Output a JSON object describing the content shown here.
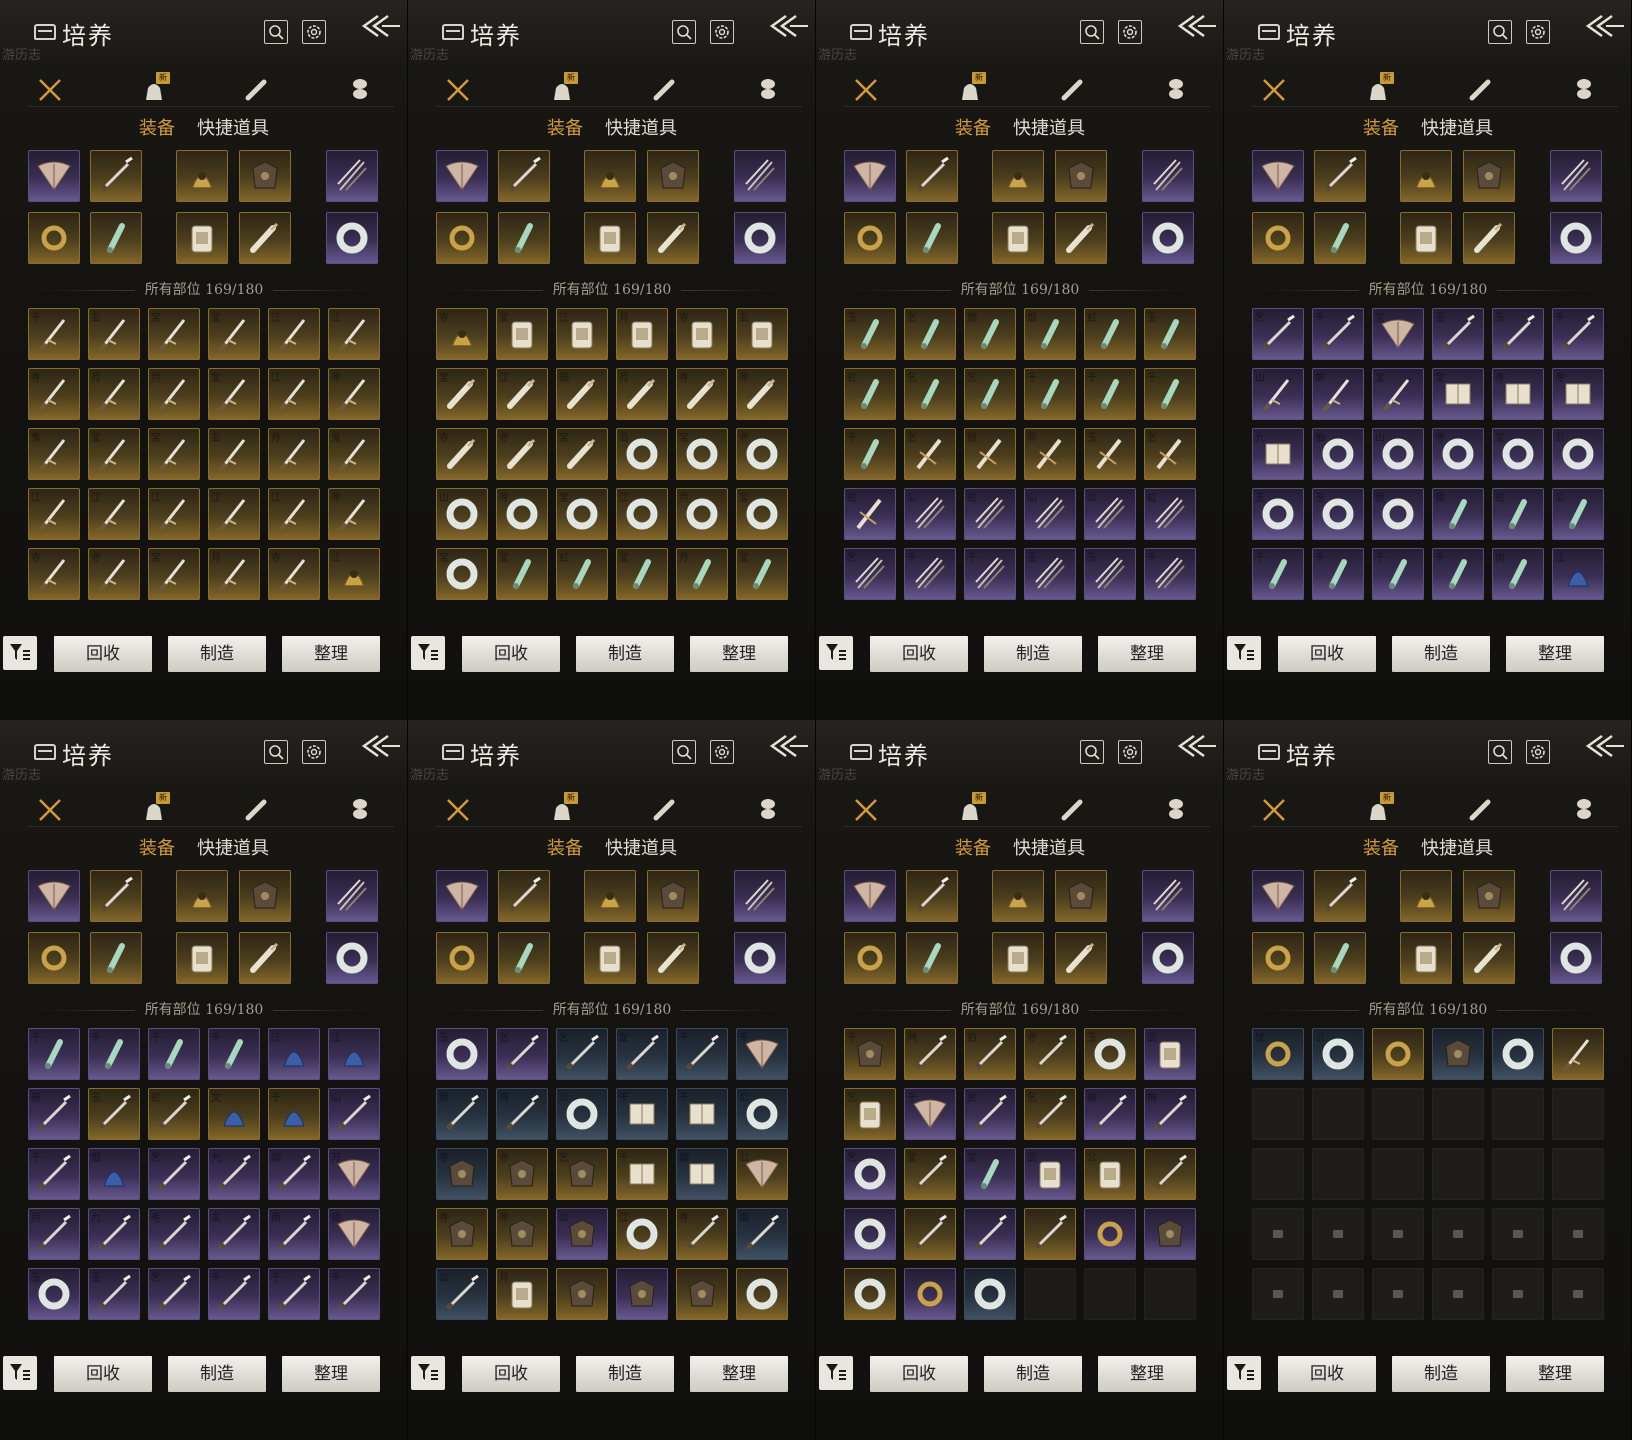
{
  "screens": [
    {
      "grid": "ggggggggggggggggggggggggggggggggggggggg",
      "chars": "千玄宝宝江江寺月月宝江寺鬼宝宝玄月鬼江江江江江寺寺寺宝月寺江宝月江千",
      "icons": "sssssssssssssssssssssssssssssaaaaaaaaaaahhhhhhhhh"
    },
    {
      "grid": "gggggggggggggggggggggggggggggggggggggggg",
      "chars": "寺宝江月寺玄宝江御月寺寺寺寺宝岛宝寺山寺宝江月宝宝宝虹宝月宝龙",
      "icons": "ahhhhhdddddddddrrrrrrrrrrjjjjj"
    },
    {
      "grid": "ggggggggggggggggggpppppppppppppppppppppp",
      "chars": "玉乞烟烟虹玉虹乞乞千千千千乞锁新玉乞虹公虹山公虹乞千千玉玉千",
      "icons": "jjjjjjjjjjjjjkkkkkkmmmmmmmmmmmmmm"
    },
    {
      "grid": "pppppppppppppppppppppppppppppppppppppp",
      "chars": "乞千宝玉玉千山邮宝宝寺寺九抽山寺宝公玉玉锁锁虹公千千千千南江",
      "icons": "wwfwwwsssttttrrrrrrrrjjjjjjjjbb"
    },
    {
      "grid": "pppppppggggpppppppppppppppppppgpppppppppp",
      "chars": "千千千千江江新玉虹文千山千烟乞九烟万月九毛玄南锁玉玉乞千千千",
      "icons": "jjjjbbwwwbbwwbwwwfwwwwwfrwwwww"
    },
    {
      "grid": "ppbbbbbbbbbbbgggbgggpggbbggpgggbpggg",
      "chars": "玉乞乞龙千千锁鸟公千千公寺寺乞千烟公寺寺公江寺烟公月",
      "icons": "rwwwwfwwrttrcccttfcccrwwwhcccrhh"
    },
    {
      "grid": "gggggpgppgpppgppggpgpgppgpb",
      "chars": "千两伯寺玉武乞千武乞柳拘乞宝宝武公",
      "icons": "cwwwrhhfwwwwrwjhhwrwwwgcrgrgc"
    },
    {
      "grid": "bbgbbg",
      "chars": "仗公",
      "icons": "grgcrsc"
    }
  ],
  "panel": {
    "title": "培养",
    "faint_label": "游历志",
    "subtabs": {
      "active": "装备",
      "inactive": "快捷道具"
    },
    "count_label": "所有部位 169/180",
    "new_badge": "新",
    "buttons": {
      "recycle": "回收",
      "craft": "制造",
      "sort": "整理"
    }
  },
  "colors": {
    "accent": "#d39a3c",
    "gold_rarity": "#86682a",
    "purple_rarity": "#6a5a92",
    "blue_rarity": "#415366"
  }
}
